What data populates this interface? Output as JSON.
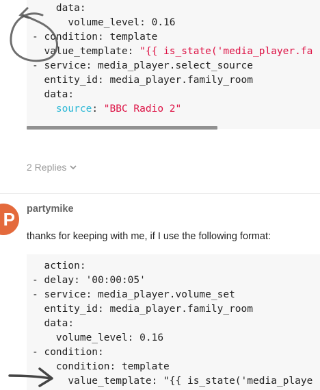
{
  "code_block_1": {
    "lines": [
      [
        {
          "t": "    data:"
        }
      ],
      [
        {
          "t": "      volume_level: 0.16"
        }
      ],
      [
        {
          "t": "- condition: template"
        }
      ],
      [
        {
          "t": "  value_template: "
        },
        {
          "t": "\"{{ is_state('media_player.fa",
          "c": "k-str"
        }
      ],
      [
        {
          "t": "- service: media_player.select_source"
        }
      ],
      [
        {
          "t": "  entity_id: media_player.family_room"
        }
      ],
      [
        {
          "t": "  data:"
        }
      ],
      [
        {
          "t": "    "
        },
        {
          "t": "source",
          "c": "k-key"
        },
        {
          "t": ": "
        },
        {
          "t": "\"BBC Radio 2\"",
          "c": "k-str"
        }
      ]
    ]
  },
  "replies": {
    "label": "2 Replies",
    "icon": "chevron-down-icon"
  },
  "post": {
    "avatar_letter": "P",
    "avatar_color": "#e46a3c",
    "username": "partymike",
    "text": "thanks for keeping with me, if I use the following format:"
  },
  "code_block_2": {
    "lines": [
      [
        {
          "t": "  action:"
        }
      ],
      [
        {
          "t": "- delay: '00:00:05'"
        }
      ],
      [
        {
          "t": "- service: media_player.volume_set"
        }
      ],
      [
        {
          "t": "  entity_id: media_player.family_room"
        }
      ],
      [
        {
          "t": "  data:"
        }
      ],
      [
        {
          "t": "    volume_level: 0.16"
        }
      ],
      [
        {
          "t": "- condition:"
        }
      ],
      [
        {
          "t": "    condition: template"
        }
      ],
      [
        {
          "t": "      value_template: \"{{ is_state('media_playe"
        }
      ]
    ]
  },
  "annotations": {
    "circle_color": "#555555",
    "arrow_color": "#444444"
  }
}
